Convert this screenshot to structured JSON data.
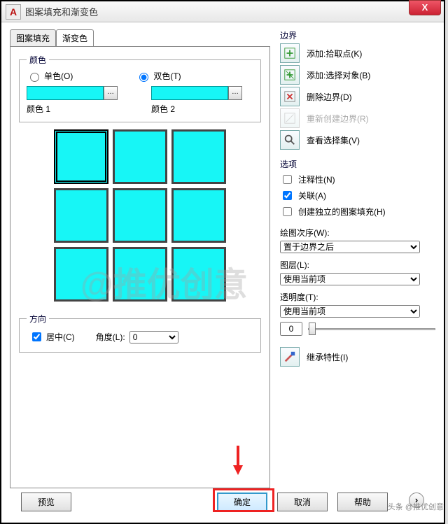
{
  "window": {
    "title": "图案填充和渐变色",
    "close": "X"
  },
  "tabs": {
    "hatch": "图案填充",
    "gradient": "渐变色"
  },
  "color": {
    "legend": "颜色",
    "one": "单色(O)",
    "two": "双色(T)",
    "color1": "颜色 1",
    "color2": "颜色 2"
  },
  "direction": {
    "legend": "方向",
    "center": "居中(C)",
    "angleLabel": "角度(L):",
    "angleValue": "0"
  },
  "boundaries": {
    "title": "边界",
    "add_pick": "添加:拾取点(K)",
    "add_select": "添加:选择对象(B)",
    "delete": "删除边界(D)",
    "recreate": "重新创建边界(R)",
    "view": "查看选择集(V)"
  },
  "options": {
    "title": "选项",
    "annot": "注释性(N)",
    "assoc": "关联(A)",
    "separate": "创建独立的图案填充(H)"
  },
  "drawOrder": {
    "label": "绘图次序(W):",
    "value": "置于边界之后"
  },
  "layer": {
    "label": "图层(L):",
    "value": "使用当前项"
  },
  "transparency": {
    "label": "透明度(T):",
    "value": "使用当前项",
    "num": "0"
  },
  "inherit": "继承特性(I)",
  "footer": {
    "preview": "预览",
    "ok": "确定",
    "cancel": "取消",
    "help": "帮助"
  },
  "watermark": "@推优创意",
  "credit": "头条 @推优创意"
}
